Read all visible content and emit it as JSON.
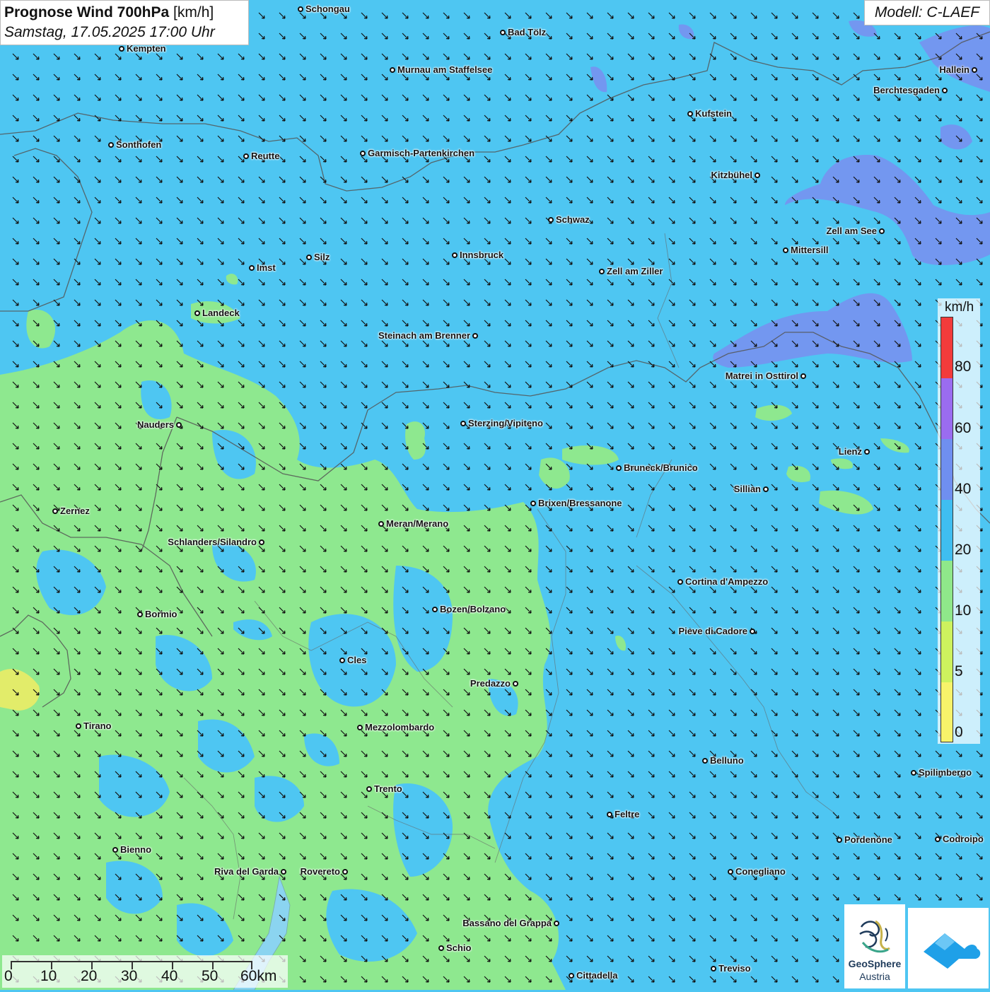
{
  "header": {
    "title_bold": "Prognose Wind 700hPa",
    "title_unit": "[km/h]",
    "datetime": "Samstag, 17.05.2025 17:00 Uhr",
    "model": "Modell: C-LAEF"
  },
  "legend": {
    "unit": "km/h",
    "labels": [
      "80",
      "60",
      "40",
      "20",
      "10",
      "5",
      "0"
    ],
    "colors": {
      "above80": "#f23b3b",
      "60_80": "#9a6cf0",
      "40_60": "#6f8ff0",
      "20_40": "#3fbef0",
      "10_20": "#8fe88a",
      "5_10": "#cdf25e",
      "0_5": "#f7f36a"
    }
  },
  "scale_bar": {
    "labels": [
      "0",
      "10",
      "20",
      "30",
      "40",
      "50",
      "60km"
    ]
  },
  "branding": {
    "logo_name": "GeoSphere",
    "logo_sub": "Austria",
    "logo_icon": "geosphere-logo-icon",
    "app_icon": "cloud-app-icon"
  },
  "cities": [
    {
      "name": "Schongau"
    },
    {
      "name": "Bad Tölz"
    },
    {
      "name": "Kempten"
    },
    {
      "name": "Murnau am Staffelsee"
    },
    {
      "name": "Hallein"
    },
    {
      "name": "Berchtesgaden"
    },
    {
      "name": "Kufstein"
    },
    {
      "name": "Sonthofen"
    },
    {
      "name": "Reutte"
    },
    {
      "name": "Garmisch-Partenkirchen"
    },
    {
      "name": "Kitzbühel"
    },
    {
      "name": "Schwaz"
    },
    {
      "name": "Zell am See"
    },
    {
      "name": "Mittersill"
    },
    {
      "name": "Innsbruck"
    },
    {
      "name": "Silz"
    },
    {
      "name": "Imst"
    },
    {
      "name": "Zell am Ziller"
    },
    {
      "name": "Landeck"
    },
    {
      "name": "Steinach am Brenner"
    },
    {
      "name": "Matrei in Osttirol"
    },
    {
      "name": "Nauders"
    },
    {
      "name": "Sterzing/Vipiteno"
    },
    {
      "name": "Lienz"
    },
    {
      "name": "Bruneck/Brunico"
    },
    {
      "name": "Sillian"
    },
    {
      "name": "Brixen/Bressanone"
    },
    {
      "name": "Zernez"
    },
    {
      "name": "Meran/Merano"
    },
    {
      "name": "Schlanders/Silandro"
    },
    {
      "name": "Cortina d'Ampezzo"
    },
    {
      "name": "Bozen/Bolzano"
    },
    {
      "name": "Bormio"
    },
    {
      "name": "Pieve di Cadore"
    },
    {
      "name": "Cles"
    },
    {
      "name": "Predazzo"
    },
    {
      "name": "Tirano"
    },
    {
      "name": "Mezzolombardo"
    },
    {
      "name": "Belluno"
    },
    {
      "name": "Spilimbergo"
    },
    {
      "name": "Trento"
    },
    {
      "name": "Feltre"
    },
    {
      "name": "Pordenone"
    },
    {
      "name": "Codroipo"
    },
    {
      "name": "Bienno"
    },
    {
      "name": "Riva del Garda"
    },
    {
      "name": "Rovereto"
    },
    {
      "name": "Conegliano"
    },
    {
      "name": "Bassano del Grappa"
    },
    {
      "name": "Schio"
    },
    {
      "name": "Treviso"
    },
    {
      "name": "Cittadella"
    }
  ]
}
